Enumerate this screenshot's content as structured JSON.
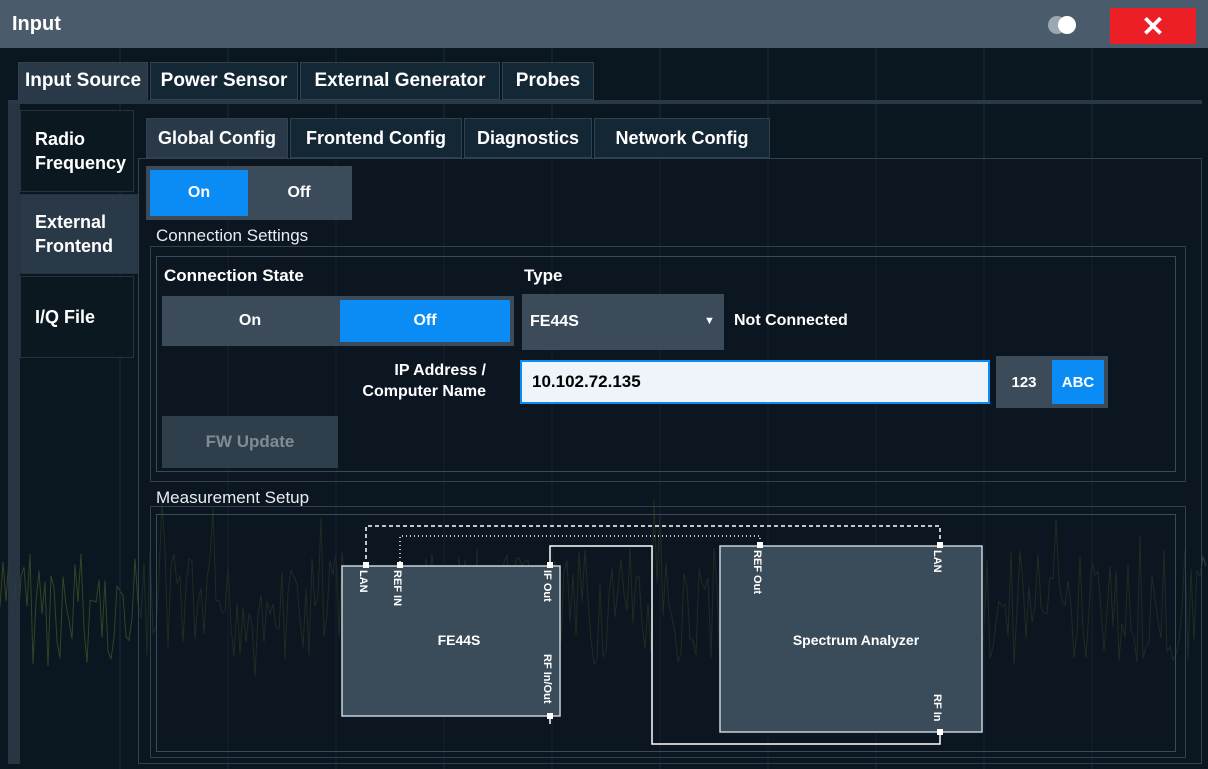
{
  "window": {
    "title": "Input",
    "close_label": "✕"
  },
  "top_tabs": [
    {
      "label": "Input Source",
      "active": true
    },
    {
      "label": "Power Sensor",
      "active": false
    },
    {
      "label": "External Generator",
      "active": false
    },
    {
      "label": "Probes",
      "active": false
    }
  ],
  "side_tabs": [
    {
      "label": "Radio Frequency",
      "active": false
    },
    {
      "label": "External Frontend",
      "active": true
    },
    {
      "label": "I/Q File",
      "active": false
    }
  ],
  "inner_tabs": [
    {
      "label": "Global Config",
      "active": true
    },
    {
      "label": "Frontend Config",
      "active": false
    },
    {
      "label": "Diagnostics",
      "active": false
    },
    {
      "label": "Network Config",
      "active": false
    }
  ],
  "global_state": {
    "on_label": "On",
    "off_label": "Off",
    "selected": "On"
  },
  "connection": {
    "section_title": "Connection Settings",
    "state_label": "Connection State",
    "state_on": "On",
    "state_off": "Off",
    "state_selected": "Off",
    "type_label": "Type",
    "type_value": "FE44S",
    "status_text": "Not Connected",
    "ip_label": "IP Address /\nComputer Name",
    "ip_value": "10.102.72.135",
    "keyboard_numeric": "123",
    "keyboard_alpha": "ABC",
    "fw_update_label": "FW Update"
  },
  "measurement": {
    "section_title": "Measurement Setup",
    "frontend_name": "FE44S",
    "analyzer_name": "Spectrum Analyzer",
    "frontend_ports": [
      "LAN",
      "REF IN",
      "IF Out",
      "RF In/Out"
    ],
    "analyzer_ports": [
      "REF Out",
      "LAN",
      "RF In"
    ]
  },
  "colors": {
    "accent": "#0b8cf5",
    "close": "#ec1f26",
    "panel": "#3b4b59",
    "titlebar": "#4a5c6b"
  },
  "icons": {
    "toggle": "display-toggle-icon",
    "close": "close-icon",
    "dropdown": "chevron-down-icon"
  }
}
